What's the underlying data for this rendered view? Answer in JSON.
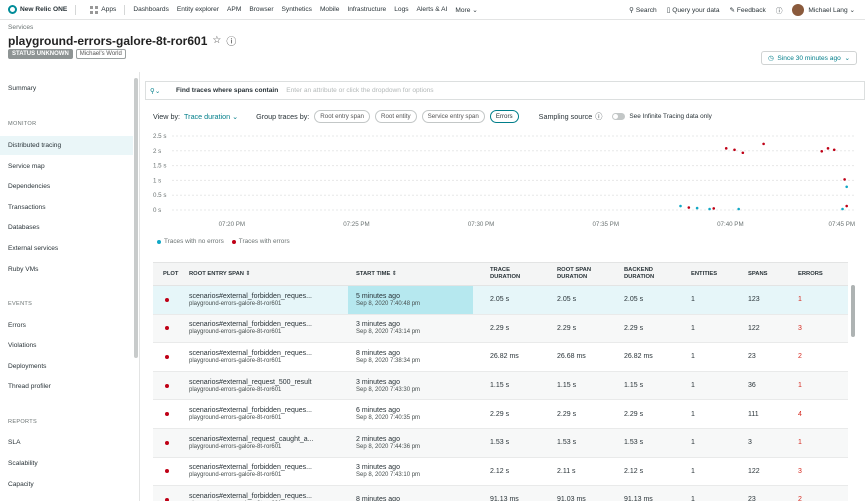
{
  "nav": {
    "brand": "New Relic ONE",
    "apps": "Apps",
    "items": [
      "Dashboards",
      "Entity explorer",
      "APM",
      "Browser",
      "Synthetics",
      "Mobile",
      "Infrastructure",
      "Logs",
      "Alerts & AI",
      "More"
    ],
    "search": "Search",
    "query": "Query your data",
    "feedback": "Feedback",
    "user": "Michael Lang"
  },
  "header": {
    "crumb": "Services",
    "title": "playground-errors-galore-8t-ror601",
    "status": "STATUS UNKNOWN",
    "account": "Michael's World",
    "time": "Since 30 minutes ago"
  },
  "sidebar": {
    "summary": "Summary",
    "monitor_label": "MONITOR",
    "monitor": [
      "Distributed tracing",
      "Service map",
      "Dependencies",
      "Transactions",
      "Databases",
      "External services",
      "Ruby VMs"
    ],
    "events_label": "EVENTS",
    "events": [
      "Errors",
      "Violations",
      "Deployments",
      "Thread profiler"
    ],
    "reports_label": "REPORTS",
    "reports": [
      "SLA",
      "Scalability",
      "Capacity"
    ]
  },
  "query": {
    "label": "Find traces where spans contain",
    "placeholder": "Enter an attribute or click the dropdown for options"
  },
  "controls": {
    "view_by": "View by:",
    "view_value": "Trace duration",
    "group_by": "Group traces by:",
    "chips": [
      "Root entry span",
      "Root entity",
      "Service entry span",
      "Errors"
    ],
    "sampling": "Sampling source",
    "toggle_label": "See Infinite Tracing data only"
  },
  "chart_data": {
    "type": "scatter",
    "y_ticks": [
      "2.5 s",
      "2 s",
      "1.5 s",
      "1 s",
      "0.5 s",
      "0 s"
    ],
    "x_ticks": [
      "07:20 PM",
      "07:25 PM",
      "07:30 PM",
      "07:35 PM",
      "07:40 PM",
      "07:45 PM"
    ],
    "ylim": [
      0,
      2.5
    ],
    "legend": [
      "Traces with no errors",
      "Traces with errors"
    ],
    "colors": {
      "no_errors": "#11a8c6",
      "errors": "#bf0016"
    },
    "series": [
      {
        "name": "Traces with errors",
        "points": [
          [
            "07:39:50 PM",
            2.05
          ],
          [
            "07:40:10 PM",
            2.0
          ],
          [
            "07:40:30 PM",
            1.9
          ],
          [
            "07:41:20 PM",
            2.2
          ],
          [
            "07:43:40 PM",
            1.95
          ],
          [
            "07:43:55 PM",
            2.05
          ],
          [
            "07:44:10 PM",
            2.0
          ],
          [
            "07:44:35 PM",
            1.0
          ],
          [
            "07:38:20 PM",
            0.05
          ],
          [
            "07:39:20 PM",
            0.02
          ],
          [
            "07:44:40 PM",
            0.1
          ]
        ]
      },
      {
        "name": "Traces with no errors",
        "points": [
          [
            "07:38:00 PM",
            0.1
          ],
          [
            "07:38:40 PM",
            0.03
          ],
          [
            "07:39:10 PM",
            0.0
          ],
          [
            "07:40:20 PM",
            0.0
          ],
          [
            "07:44:40 PM",
            0.75
          ],
          [
            "07:44:30 PM",
            0.0
          ]
        ]
      }
    ]
  },
  "table": {
    "headers": [
      "PLOT",
      "ROOT ENTRY SPAN",
      "START TIME",
      "TRACE DURATION",
      "ROOT SPAN DURATION",
      "BACKEND DURATION",
      "ENTITIES",
      "SPANS",
      "ERRORS"
    ],
    "rows": [
      {
        "span": "scenarios#external_forbidden_reques...",
        "entity": "playground-errors-galore-8t-ror601",
        "ago": "5 minutes ago",
        "time": "Sep 8, 2020 7:40:48 pm",
        "trace": "2.05 s",
        "root": "2.05 s",
        "backend": "2.05 s",
        "entities": "1",
        "spans": "123",
        "errors": "1"
      },
      {
        "span": "scenarios#external_forbidden_reques...",
        "entity": "playground-errors-galore-8t-ror601",
        "ago": "3 minutes ago",
        "time": "Sep 8, 2020 7:43:14 pm",
        "trace": "2.29 s",
        "root": "2.29 s",
        "backend": "2.29 s",
        "entities": "1",
        "spans": "122",
        "errors": "3"
      },
      {
        "span": "scenarios#external_forbidden_reques...",
        "entity": "playground-errors-galore-8t-ror601",
        "ago": "8 minutes ago",
        "time": "Sep 8, 2020 7:38:34 pm",
        "trace": "26.82 ms",
        "root": "26.68 ms",
        "backend": "26.82 ms",
        "entities": "1",
        "spans": "23",
        "errors": "2"
      },
      {
        "span": "scenarios#external_request_500_result",
        "entity": "playground-errors-galore-8t-ror601",
        "ago": "3 minutes ago",
        "time": "Sep 8, 2020 7:43:30 pm",
        "trace": "1.15 s",
        "root": "1.15 s",
        "backend": "1.15 s",
        "entities": "1",
        "spans": "36",
        "errors": "1"
      },
      {
        "span": "scenarios#external_forbidden_reques...",
        "entity": "playground-errors-galore-8t-ror601",
        "ago": "6 minutes ago",
        "time": "Sep 8, 2020 7:40:35 pm",
        "trace": "2.29 s",
        "root": "2.29 s",
        "backend": "2.29 s",
        "entities": "1",
        "spans": "111",
        "errors": "4"
      },
      {
        "span": "scenarios#external_request_caught_a...",
        "entity": "playground-errors-galore-8t-ror601",
        "ago": "2 minutes ago",
        "time": "Sep 8, 2020 7:44:36 pm",
        "trace": "1.53 s",
        "root": "1.53 s",
        "backend": "1.53 s",
        "entities": "1",
        "spans": "3",
        "errors": "1"
      },
      {
        "span": "scenarios#external_forbidden_reques...",
        "entity": "playground-errors-galore-8t-ror601",
        "ago": "3 minutes ago",
        "time": "Sep 8, 2020 7:43:10 pm",
        "trace": "2.12 s",
        "root": "2.11 s",
        "backend": "2.12 s",
        "entities": "1",
        "spans": "122",
        "errors": "3"
      },
      {
        "span": "scenarios#external_forbidden_reques...",
        "entity": "playground-errors-galore-8t-ror601",
        "ago": "8 minutes ago",
        "time": "",
        "trace": "91.13 ms",
        "root": "91.03 ms",
        "backend": "91.13 ms",
        "entities": "1",
        "spans": "23",
        "errors": "2"
      }
    ]
  }
}
